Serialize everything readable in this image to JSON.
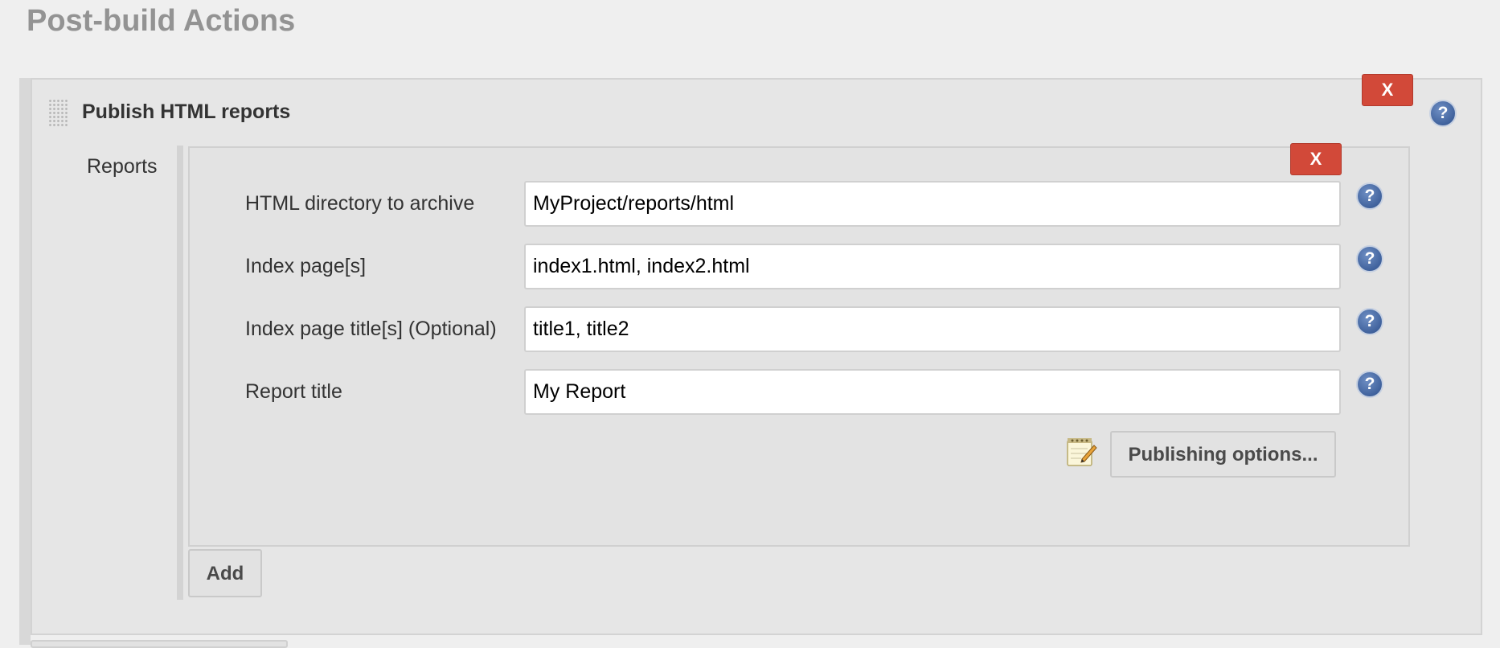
{
  "page": {
    "title": "Post-build Actions"
  },
  "section": {
    "title": "Publish HTML reports",
    "delete_label": "X",
    "help_label": "?"
  },
  "reports": {
    "label": "Reports",
    "delete_label": "X",
    "fields": [
      {
        "label": "HTML directory to archive",
        "value": "MyProject/reports/html"
      },
      {
        "label": "Index page[s]",
        "value": "index1.html, index2.html"
      },
      {
        "label": "Index page title[s] (Optional)",
        "value": "title1, title2"
      },
      {
        "label": "Report title",
        "value": "My Report"
      }
    ],
    "help_label": "?",
    "publishing_options_label": "Publishing options...",
    "notepad_icon": "notepad-pencil-icon",
    "add_label": "Add"
  },
  "colors": {
    "delete_button": "#d24939",
    "help_icon": "#2c4f8c",
    "title_gray": "#939393"
  }
}
